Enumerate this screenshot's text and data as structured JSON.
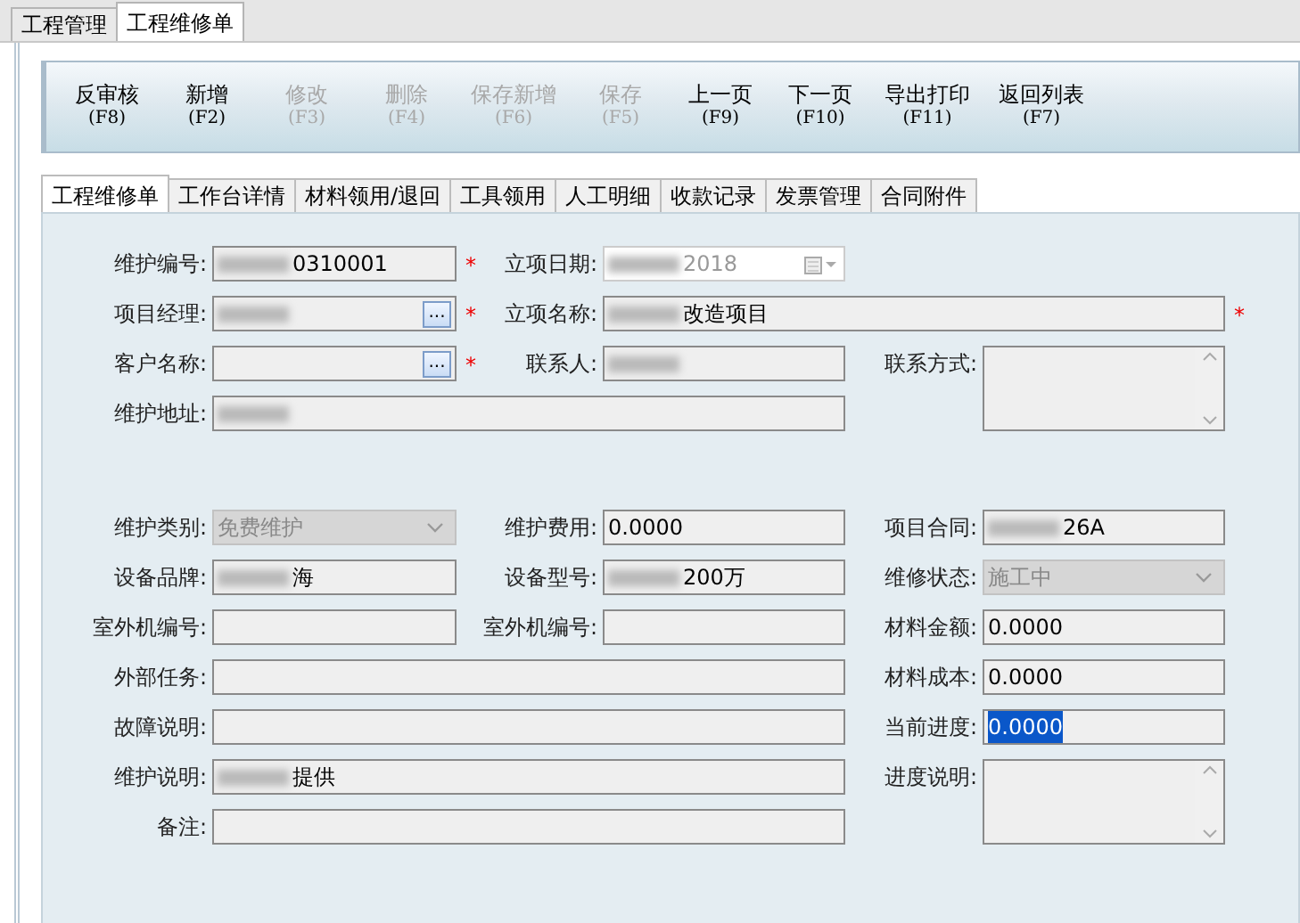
{
  "top_tabs": [
    {
      "label": "工程管理",
      "selected": false
    },
    {
      "label": "工程维修单",
      "selected": true
    }
  ],
  "toolbar": [
    {
      "label": "反审核",
      "key": "(F8)",
      "disabled": false
    },
    {
      "label": "新增",
      "key": "(F2)",
      "disabled": false
    },
    {
      "label": "修改",
      "key": "(F3)",
      "disabled": true
    },
    {
      "label": "删除",
      "key": "(F4)",
      "disabled": true
    },
    {
      "label": "保存新增",
      "key": "(F6)",
      "disabled": true
    },
    {
      "label": "保存",
      "key": "(F5)",
      "disabled": true
    },
    {
      "label": "上一页",
      "key": "(F9)",
      "disabled": false
    },
    {
      "label": "下一页",
      "key": "(F10)",
      "disabled": false
    },
    {
      "label": "导出打印",
      "key": "(F11)",
      "disabled": false
    },
    {
      "label": "返回列表",
      "key": "(F7)",
      "disabled": false
    }
  ],
  "tabs": [
    {
      "label": "工程维修单",
      "selected": true
    },
    {
      "label": "工作台详情",
      "selected": false
    },
    {
      "label": "材料领用/退回",
      "selected": false
    },
    {
      "label": "工具领用",
      "selected": false
    },
    {
      "label": "人工明细",
      "selected": false
    },
    {
      "label": "收款记录",
      "selected": false
    },
    {
      "label": "发票管理",
      "selected": false
    },
    {
      "label": "合同附件",
      "selected": false
    }
  ],
  "required_mark": "*",
  "lookup_button": "...",
  "groups": [
    {
      "rows": [
        {
          "cells": [
            {
              "kind": "text",
              "label": "维护编号:",
              "value": "0310001",
              "blurred": true,
              "required": true
            },
            {
              "kind": "date",
              "label": "立项日期:",
              "value": "2018",
              "blurred": true,
              "disabled": true
            }
          ]
        },
        {
          "cells": [
            {
              "kind": "lookup",
              "label": "项目经理:",
              "blurred": true,
              "required": true
            },
            {
              "kind": "text",
              "label": "立项名称:",
              "value": "改造项目",
              "blurred": true,
              "required": true,
              "wide": true
            }
          ]
        },
        {
          "cells": [
            {
              "kind": "lookup",
              "label": "客户名称:",
              "required": true
            },
            {
              "kind": "text",
              "label": "联系人:",
              "blurred": true
            },
            {
              "kind": "memo",
              "label": "联系方式:"
            }
          ]
        },
        {
          "cells": [
            {
              "kind": "text",
              "label": "维护地址:",
              "blurred": true,
              "wide": true
            }
          ]
        }
      ]
    },
    {
      "rows": [
        {
          "cells": [
            {
              "kind": "combo",
              "label": "维护类别:",
              "value": "免费维护",
              "disabled": true
            },
            {
              "kind": "text",
              "label": "维护费用:",
              "value": "0.0000"
            },
            {
              "kind": "text",
              "label": "项目合同:",
              "value": "26A",
              "blurred": true
            }
          ]
        },
        {
          "cells": [
            {
              "kind": "text",
              "label": "设备品牌:",
              "value": "海",
              "blurred": true
            },
            {
              "kind": "text",
              "label": "设备型号:",
              "value": "200万",
              "blurred": true
            },
            {
              "kind": "combo",
              "label": "维修状态:",
              "value": "施工中",
              "disabled": true
            }
          ]
        },
        {
          "cells": [
            {
              "kind": "text",
              "label": "室外机编号:"
            },
            {
              "kind": "text",
              "label": "室外机编号:"
            },
            {
              "kind": "text",
              "label": "材料金额:",
              "value": "0.0000"
            }
          ]
        },
        {
          "cells": [
            {
              "kind": "text",
              "label": "外部任务:",
              "wide": true
            },
            {
              "kind": "text",
              "label": "材料成本:",
              "value": "0.0000"
            }
          ]
        },
        {
          "cells": [
            {
              "kind": "text",
              "label": "故障说明:",
              "wide": true
            },
            {
              "kind": "text",
              "label": "当前进度:",
              "value": "0.0000",
              "highlighted": true
            }
          ]
        },
        {
          "cells": [
            {
              "kind": "text",
              "label": "维护说明:",
              "value": "提供",
              "blurred": true,
              "wide": true
            },
            {
              "kind": "memo",
              "label": "进度说明:"
            }
          ]
        },
        {
          "cells": [
            {
              "kind": "text",
              "label": "备注:",
              "wide": true
            }
          ]
        }
      ]
    }
  ]
}
